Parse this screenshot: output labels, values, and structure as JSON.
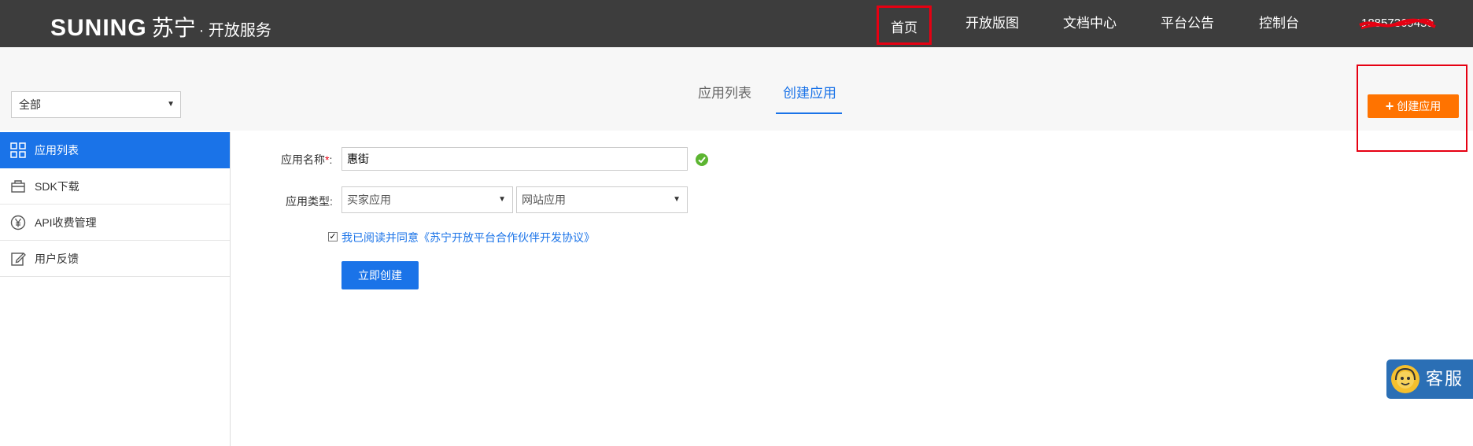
{
  "header": {
    "logo_brand": "SUNING",
    "logo_brand_cn": "苏宁",
    "logo_sub": "· 开放服务",
    "nav": [
      "首页",
      "开放版图",
      "文档中心",
      "平台公告",
      "控制台"
    ],
    "phone": "18857369450"
  },
  "filter": {
    "selected": "全部"
  },
  "tabs": {
    "list": "应用列表",
    "create": "创建应用"
  },
  "create_button": "创建应用",
  "sidebar": {
    "items": [
      {
        "label": "应用列表",
        "icon": "grid-icon"
      },
      {
        "label": "SDK下载",
        "icon": "box-icon"
      },
      {
        "label": "API收费管理",
        "icon": "yen-icon"
      },
      {
        "label": "用户反馈",
        "icon": "edit-icon"
      }
    ]
  },
  "form": {
    "name_label": "应用名称",
    "name_required": "*",
    "name_colon": ":",
    "name_value": "惠街",
    "type_label": "应用类型:",
    "type_primary": "买家应用",
    "type_secondary": "网站应用",
    "agreement": "我已阅读并同意《苏宁开放平台合作伙伴开发协议》",
    "submit": "立即创建"
  },
  "customer_service": {
    "label": "客服精"
  },
  "colors": {
    "primary": "#1a73e8",
    "orange": "#ff7300",
    "header": "#3d3d3d",
    "highlight": "#e60012"
  }
}
